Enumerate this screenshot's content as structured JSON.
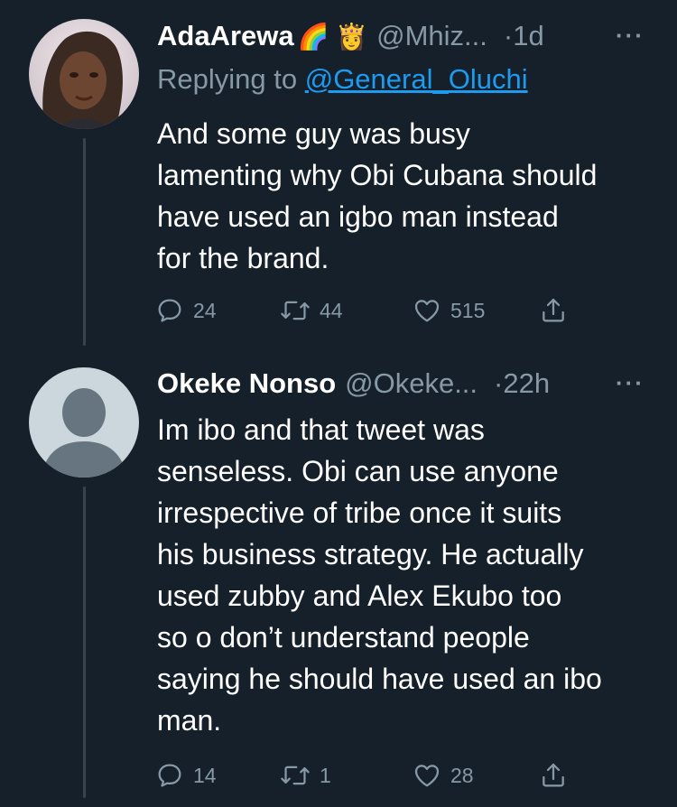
{
  "tweets": [
    {
      "name": "AdaArewa",
      "emojis": "🌈 👸",
      "handle": "@Mhiz...",
      "time": "1d",
      "more": "···",
      "replying_prefix": "Replying to ",
      "replying_to": "@General_Oluchi",
      "text": "And some guy was busy\nlamenting why Obi Cubana should\nhave used an igbo man instead\nfor the brand.",
      "replies": "24",
      "retweets": "44",
      "likes": "515",
      "avatar": "profile-photo"
    },
    {
      "name": "Okeke Nonso",
      "handle": "@Okeke...",
      "time": "22h",
      "more": "···",
      "text": "Im ibo and that tweet was\nsenseless. Obi can use anyone\nirrespective of tribe once it suits\nhis business strategy. He actually\nused zubby and Alex Ekubo too\nso o don’t understand people\nsaying he should have used an ibo\nman.",
      "replies": "14",
      "retweets": "1",
      "likes": "28",
      "avatar": "default-avatar"
    }
  ],
  "separator": "·",
  "icons": {
    "reply": "reply-icon",
    "retweet": "retweet-icon",
    "like": "heart-icon",
    "share": "share-icon"
  },
  "colors": {
    "background": "#15202b",
    "text": "#ffffff",
    "secondary": "#8899a6",
    "link": "#1d9bf0",
    "thread_line": "#38444d"
  }
}
